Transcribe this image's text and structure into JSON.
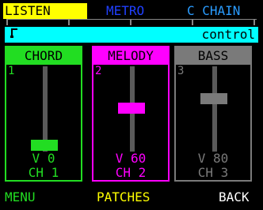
{
  "tabs": {
    "listen": "LISTEN",
    "metro": "METRO",
    "c_chain": "C CHAIN"
  },
  "control_bar": {
    "label": "control",
    "icon": "note-icon"
  },
  "panels": [
    {
      "name": "CHORD",
      "number": "1",
      "velocity": "V 0",
      "channel": "CH 1",
      "slider_level": 0.1
    },
    {
      "name": "MELODY",
      "number": "2",
      "velocity": "V 60",
      "channel": "CH 2",
      "slider_level": 0.55
    },
    {
      "name": "BASS",
      "number": "3",
      "velocity": "V 80",
      "channel": "CH 3",
      "slider_level": 0.67
    }
  ],
  "footer": {
    "menu": "MENU",
    "patches": "PATCHES",
    "back": "BACK"
  },
  "colors": {
    "chord": "#22dd22",
    "melody": "#ff00ff",
    "bass": "#7a7a7a",
    "listen_tab": "#ffff00",
    "control_bar": "#00ffff"
  }
}
